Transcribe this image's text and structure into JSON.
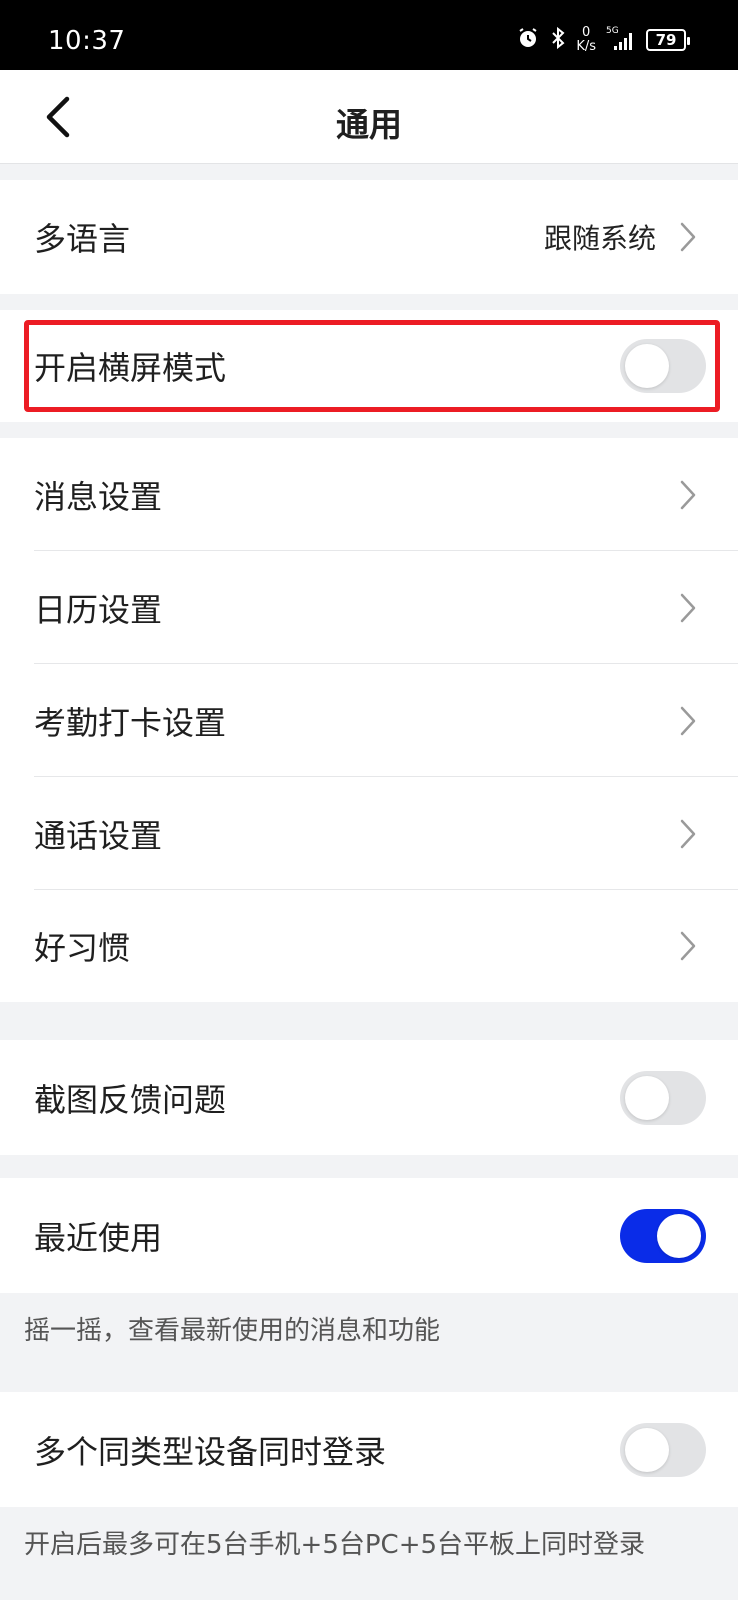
{
  "status_bar": {
    "time": "10:37",
    "net_speed_value": "0",
    "net_speed_unit": "K/s",
    "network": "5G",
    "battery": "79"
  },
  "header": {
    "title": "通用",
    "back_icon": "chevron-left-icon"
  },
  "rows": {
    "language": {
      "label": "多语言",
      "value": "跟随系统"
    },
    "landscape": {
      "label": "开启横屏模式",
      "toggle": false
    },
    "message": {
      "label": "消息设置"
    },
    "calendar": {
      "label": "日历设置"
    },
    "attendance": {
      "label": "考勤打卡设置"
    },
    "call": {
      "label": "通话设置"
    },
    "habit": {
      "label": "好习惯"
    },
    "feedback": {
      "label": "截图反馈问题",
      "toggle": false
    },
    "recent": {
      "label": "最近使用",
      "toggle": true,
      "hint": "摇一摇，查看最新使用的消息和功能"
    },
    "multi_login": {
      "label": "多个同类型设备同时登录",
      "toggle": false,
      "hint": "开启后最多可在5台手机+5台PC+5台平板上同时登录"
    }
  },
  "colors": {
    "accent": "#0a2ce8",
    "highlight": "#ec1c24"
  }
}
